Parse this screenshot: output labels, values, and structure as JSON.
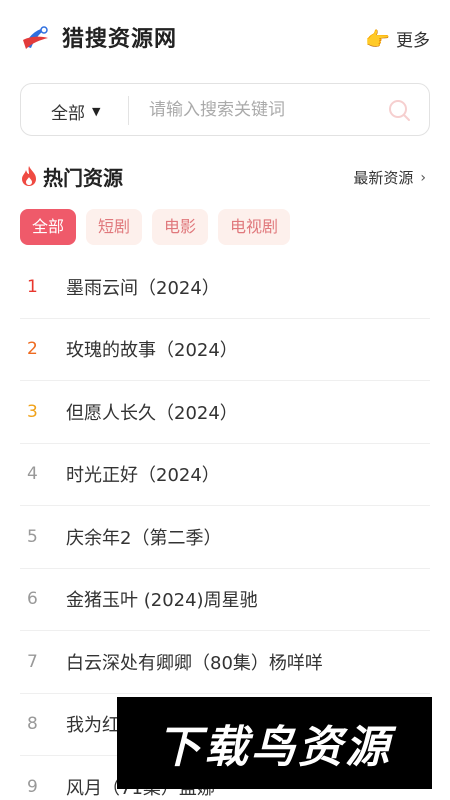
{
  "header": {
    "app_title": "猎搜资源网",
    "more_label": "更多",
    "more_icon": "👉"
  },
  "search": {
    "scope_label": "全部",
    "placeholder": "请输入搜索关键词"
  },
  "hot_section": {
    "title": "热门资源",
    "latest_link": "最新资源"
  },
  "tabs": [
    {
      "label": "全部",
      "active": true
    },
    {
      "label": "短剧",
      "active": false
    },
    {
      "label": "电影",
      "active": false
    },
    {
      "label": "电视剧",
      "active": false
    }
  ],
  "items": [
    {
      "rank": "1",
      "title": "墨雨云间（2024）"
    },
    {
      "rank": "2",
      "title": "玫瑰的故事（2024）"
    },
    {
      "rank": "3",
      "title": "但愿人长久（2024）"
    },
    {
      "rank": "4",
      "title": "时光正好（2024）"
    },
    {
      "rank": "5",
      "title": "庆余年2（第二季）"
    },
    {
      "rank": "6",
      "title": "金猪玉叶 (2024)周星驰"
    },
    {
      "rank": "7",
      "title": "白云深处有卿卿（80集）杨咩咩"
    },
    {
      "rank": "8",
      "title": "我为红"
    },
    {
      "rank": "9",
      "title": "风月（71集）盖娜"
    }
  ],
  "rank_colors": [
    "#e8372e",
    "#ee6a1f",
    "#f0a21a",
    "#999999"
  ],
  "watermark": {
    "text": "下载鸟资源"
  },
  "colors": {
    "accent": "#ef5a6a",
    "tab_bg": "#fdf0ec",
    "tab_text": "#e0787c"
  }
}
